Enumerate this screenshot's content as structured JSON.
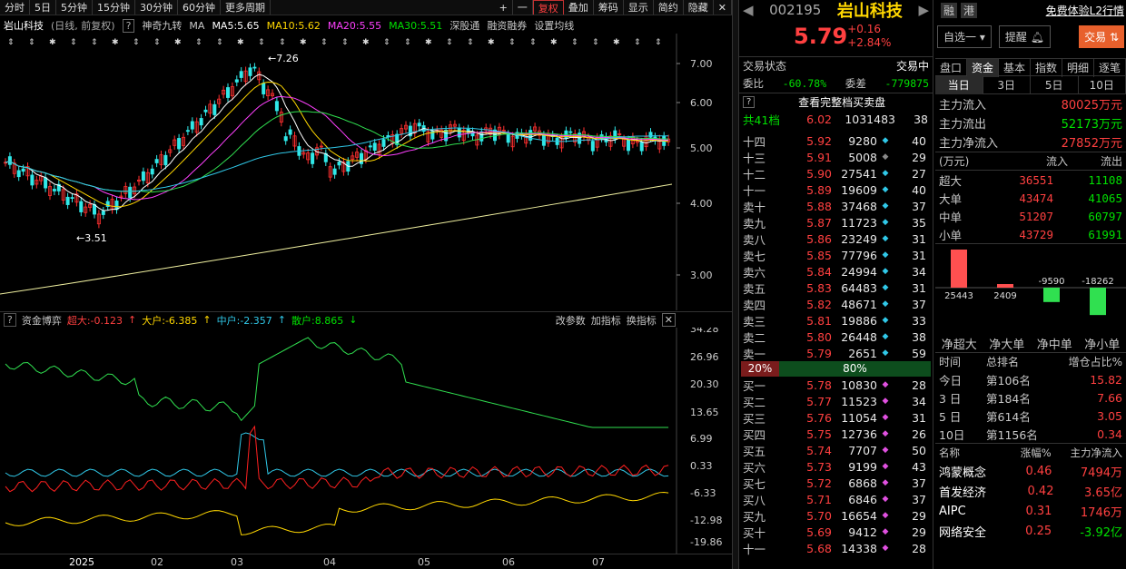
{
  "toolbar": {
    "periods": [
      "分时",
      "5日",
      "5分钟",
      "15分钟",
      "30分钟",
      "60分钟",
      "更多周期"
    ],
    "actions": [
      "+",
      "一",
      "复权",
      "叠加",
      "筹码",
      "显示",
      "简约",
      "隐藏"
    ]
  },
  "info": {
    "name": "岩山科技",
    "mode": "(日线, 前复权)",
    "help": "?",
    "indicator_name": "神奇九转",
    "ma_label": "MA",
    "ma5": "MA5:5.65",
    "ma10": "MA10:5.62",
    "ma20": "MA20:5.55",
    "ma30": "MA30:5.51",
    "tab1": "深股通",
    "tab2": "融资融券",
    "tab3": "设置均线"
  },
  "main_axis": [
    "7.00",
    "6.00",
    "5.00",
    "4.00",
    "3.00"
  ],
  "annotations": {
    "high": "7.26",
    "low": "3.51"
  },
  "indicator": {
    "name": "资金博弈",
    "super": "超大:-0.123",
    "big": "大户:-6.385",
    "mid": "中户:-2.357",
    "retail": "散户:8.865",
    "btn1": "改参数",
    "btn2": "加指标",
    "btn3": "换指标",
    "axis": [
      "34.28",
      "26.96",
      "20.30",
      "13.65",
      "6.99",
      "0.33",
      "-6.33",
      "-12.98",
      "-19.86"
    ]
  },
  "xaxis": [
    "2025",
    "02",
    "03",
    "04",
    "05",
    "06",
    "07"
  ],
  "quote": {
    "code": "002195",
    "name": "岩山科技",
    "price": "5.79",
    "change": "+0.16",
    "pct": "+2.84%",
    "tag1": "融",
    "tag2": "港",
    "l2": "免费体验L2行情",
    "btn_watch": "自选一",
    "btn_alert": "提醒",
    "btn_trade": "交易"
  },
  "status": {
    "label": "交易状态",
    "value": "交易中",
    "wb_label": "委比",
    "wb": "-60.78%",
    "wc_label": "委差",
    "wc": "-779875",
    "full": "查看完整档买卖盘",
    "total_label": "共41档",
    "total_price": "6.02",
    "total_vol": "1031483",
    "total_cnt": "38"
  },
  "asks": [
    {
      "lv": "十四",
      "p": "5.92",
      "v": "9280",
      "c": "40",
      "dot": "cyan"
    },
    {
      "lv": "十三",
      "p": "5.91",
      "v": "5008",
      "c": "29",
      "dot": "grey"
    },
    {
      "lv": "十二",
      "p": "5.90",
      "v": "27541",
      "c": "27",
      "dot": "cyan"
    },
    {
      "lv": "十一",
      "p": "5.89",
      "v": "19609",
      "c": "40",
      "dot": "cyan"
    },
    {
      "lv": "卖十",
      "p": "5.88",
      "v": "37468",
      "c": "37",
      "dot": "cyan"
    },
    {
      "lv": "卖九",
      "p": "5.87",
      "v": "11723",
      "c": "35",
      "dot": "cyan"
    },
    {
      "lv": "卖八",
      "p": "5.86",
      "v": "23249",
      "c": "31",
      "dot": "cyan"
    },
    {
      "lv": "卖七",
      "p": "5.85",
      "v": "77796",
      "c": "31",
      "dot": "cyan"
    },
    {
      "lv": "卖六",
      "p": "5.84",
      "v": "24994",
      "c": "34",
      "dot": "cyan"
    },
    {
      "lv": "卖五",
      "p": "5.83",
      "v": "64483",
      "c": "31",
      "dot": "cyan"
    },
    {
      "lv": "卖四",
      "p": "5.82",
      "v": "48671",
      "c": "37",
      "dot": "cyan"
    },
    {
      "lv": "卖三",
      "p": "5.81",
      "v": "19886",
      "c": "33",
      "dot": "cyan"
    },
    {
      "lv": "卖二",
      "p": "5.80",
      "v": "26448",
      "c": "38",
      "dot": "cyan"
    },
    {
      "lv": "卖一",
      "p": "5.79",
      "v": "2651",
      "c": "59",
      "dot": "cyan"
    }
  ],
  "ratio": {
    "sell": "20%",
    "buy": "80%",
    "sell_frac": 0.2
  },
  "bids": [
    {
      "lv": "买一",
      "p": "5.78",
      "v": "10830",
      "c": "28",
      "dot": "magenta"
    },
    {
      "lv": "买二",
      "p": "5.77",
      "v": "11523",
      "c": "34",
      "dot": "magenta"
    },
    {
      "lv": "买三",
      "p": "5.76",
      "v": "11054",
      "c": "31",
      "dot": "magenta"
    },
    {
      "lv": "买四",
      "p": "5.75",
      "v": "12736",
      "c": "26",
      "dot": "magenta"
    },
    {
      "lv": "买五",
      "p": "5.74",
      "v": "7707",
      "c": "50",
      "dot": "magenta"
    },
    {
      "lv": "买六",
      "p": "5.73",
      "v": "9199",
      "c": "43",
      "dot": "magenta"
    },
    {
      "lv": "买七",
      "p": "5.72",
      "v": "6868",
      "c": "37",
      "dot": "magenta"
    },
    {
      "lv": "买八",
      "p": "5.71",
      "v": "6846",
      "c": "37",
      "dot": "magenta"
    },
    {
      "lv": "买九",
      "p": "5.70",
      "v": "16654",
      "c": "29",
      "dot": "magenta"
    },
    {
      "lv": "买十",
      "p": "5.69",
      "v": "9412",
      "c": "29",
      "dot": "magenta"
    },
    {
      "lv": "十一",
      "p": "5.68",
      "v": "14338",
      "c": "28",
      "dot": "magenta"
    }
  ],
  "tabs": [
    "盘口",
    "资金",
    "基本",
    "指数",
    "明细",
    "逐笔"
  ],
  "subtabs": [
    "当日",
    "3日",
    "5日",
    "10日"
  ],
  "flow": [
    {
      "label": "主力流入",
      "value": "80025万元",
      "color": "red"
    },
    {
      "label": "主力流出",
      "value": "52173万元",
      "color": "green"
    },
    {
      "label": "主力净流入",
      "value": "27852万元",
      "color": "red"
    }
  ],
  "flow_table": {
    "unit": "(万元)",
    "in": "流入",
    "out": "流出",
    "rows": [
      {
        "label": "超大",
        "in": "36551",
        "out": "11108"
      },
      {
        "label": "大单",
        "in": "43474",
        "out": "41065"
      },
      {
        "label": "中单",
        "in": "51207",
        "out": "60797"
      },
      {
        "label": "小单",
        "in": "43729",
        "out": "61991"
      }
    ]
  },
  "net_chart": {
    "values": [
      25443,
      2409,
      -9590,
      -18262
    ],
    "labels": [
      "净超大",
      "净大单",
      "净中单",
      "净小单"
    ]
  },
  "rank": {
    "headers": [
      "时间",
      "总排名",
      "增仓占比%"
    ],
    "rows": [
      {
        "t": "今日",
        "r": "第106名",
        "v": "15.82"
      },
      {
        "t": "3 日",
        "r": "第184名",
        "v": "7.66"
      },
      {
        "t": "5 日",
        "r": "第614名",
        "v": "3.05"
      },
      {
        "t": "10日",
        "r": "第1156名",
        "v": "0.34"
      }
    ]
  },
  "sectors": {
    "headers": [
      "名称",
      "涨幅%",
      "主力净流入"
    ],
    "rows": [
      {
        "n": "鸿蒙概念",
        "p": "0.46",
        "f": "7494万",
        "fc": "red"
      },
      {
        "n": "首发经济",
        "p": "0.42",
        "f": "3.65亿",
        "fc": "red"
      },
      {
        "n": "AIPC",
        "p": "0.31",
        "f": "1746万",
        "fc": "red"
      },
      {
        "n": "网络安全",
        "p": "0.25",
        "f": "-3.92亿",
        "fc": "green"
      }
    ]
  }
}
